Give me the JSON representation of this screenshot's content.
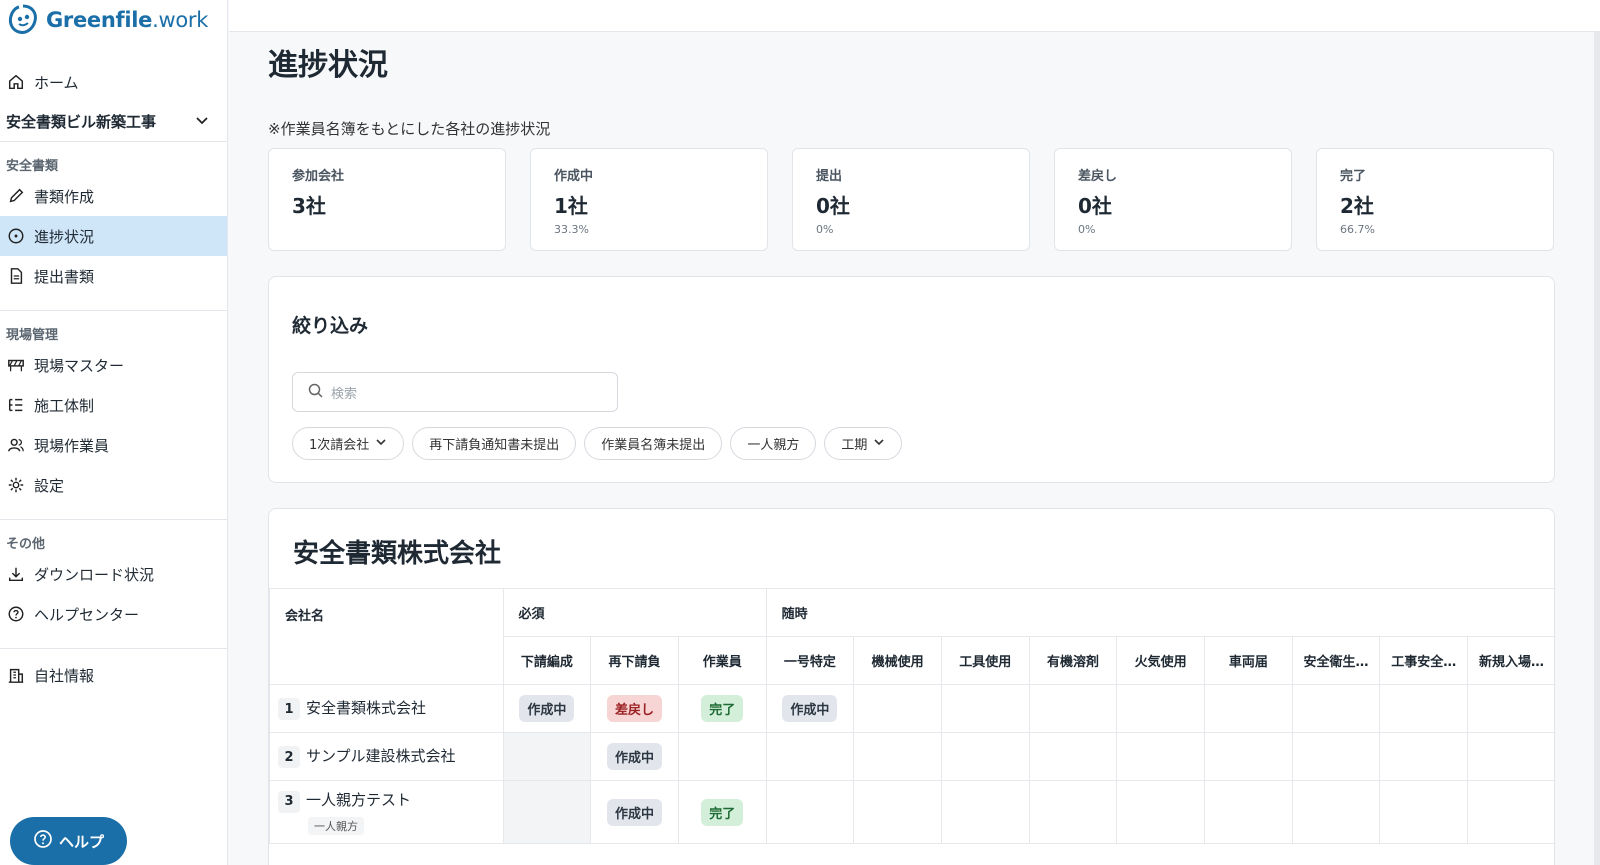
{
  "brand": {
    "name_bold": "Greenfile",
    "name_light": ".work",
    "color": "#1b6fa8"
  },
  "sidebar": {
    "home": "ホーム",
    "project": "安全書類ビル新築工事",
    "sections": [
      {
        "label": "安全書類",
        "items": [
          "書類作成",
          "進捗状況",
          "提出書類"
        ]
      },
      {
        "label": "現場管理",
        "items": [
          "現場マスター",
          "施工体制",
          "現場作業員",
          "設定"
        ]
      },
      {
        "label": "その他",
        "items": [
          "ダウンロード状況",
          "ヘルプセンター"
        ]
      }
    ],
    "company_info": "自社情報",
    "active": "進捗状況",
    "help_button": "ヘルプ"
  },
  "page": {
    "title": "進捗状況",
    "note": "※作業員名簿をもとにした各社の進捗状況"
  },
  "stats": [
    {
      "label": "参加会社",
      "value": "3社",
      "pct": ""
    },
    {
      "label": "作成中",
      "value": "1社",
      "pct": "33.3%"
    },
    {
      "label": "提出",
      "value": "0社",
      "pct": "0%"
    },
    {
      "label": "差戻し",
      "value": "0社",
      "pct": "0%"
    },
    {
      "label": "完了",
      "value": "2社",
      "pct": "66.7%"
    }
  ],
  "filter": {
    "title": "絞り込み",
    "search_placeholder": "検索",
    "chips": [
      "1次請会社",
      "再下請負通知書未提出",
      "作業員名簿未提出",
      "一人親方",
      "工期"
    ]
  },
  "table": {
    "company_title": "安全書類株式会社",
    "col_company": "会社名",
    "group_required": "必須",
    "group_optional": "随時",
    "required_cols": [
      "下請編成",
      "再下請負",
      "作業員"
    ],
    "optional_cols": [
      "一号特定",
      "機械使用",
      "工具使用",
      "有機溶剤",
      "火気使用",
      "車両届",
      "安全衛生…",
      "工事安全…",
      "新規入場…"
    ],
    "rows": [
      {
        "num": "1",
        "name": "安全書類株式会社",
        "tag": "",
        "cells": [
          "作成中",
          "差戻し",
          "完了",
          "作成中",
          "",
          "",
          "",
          "",
          "",
          "",
          "",
          ""
        ]
      },
      {
        "num": "2",
        "name": "サンプル建設株式会社",
        "tag": "",
        "cells": [
          "",
          "作成中",
          "",
          "",
          "",
          "",
          "",
          "",
          "",
          "",
          "",
          ""
        ]
      },
      {
        "num": "3",
        "name": "一人親方テスト",
        "tag": "一人親方",
        "cells": [
          "",
          "作成中",
          "完了",
          "",
          "",
          "",
          "",
          "",
          "",
          "",
          "",
          ""
        ]
      }
    ]
  }
}
